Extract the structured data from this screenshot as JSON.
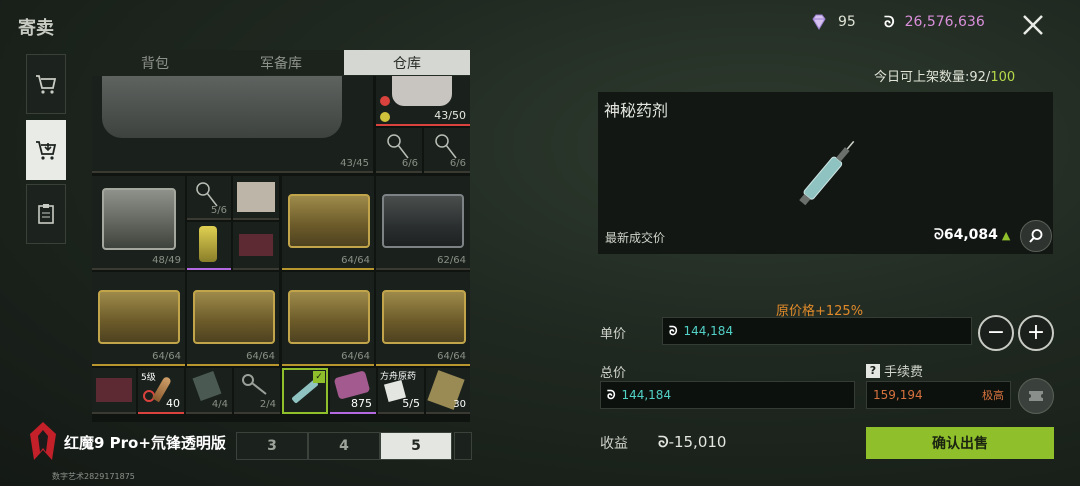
{
  "header": {
    "title": "寄卖",
    "diamonds": "95",
    "coins": "26,576,636",
    "quota_prefix": "今日可上架数量:92/",
    "quota_max": "100"
  },
  "tabs": [
    {
      "label": "背包",
      "active": false
    },
    {
      "label": "军备库",
      "active": false
    },
    {
      "label": "仓库",
      "active": true
    }
  ],
  "grid": {
    "counts": [
      "43/45",
      "43/50",
      "6/6",
      "6/6",
      "5/6",
      "48/49",
      "64/64",
      "62/64",
      "64/64",
      "64/64",
      "64/64",
      "64/64",
      "40",
      "4/4",
      "2/4",
      "875",
      "5/5",
      "30"
    ],
    "labels": {
      "level": "5级",
      "item_tag": "方舟原药"
    }
  },
  "pagination": {
    "pages": [
      "3",
      "4",
      "5"
    ],
    "active": "5"
  },
  "watermark": {
    "brand": "红魔9 Pro+氘锋透明版",
    "sub": "数字艺术2829171875"
  },
  "item": {
    "name": "神秘药剂",
    "last_price_label": "最新成交价",
    "last_price": "64,084"
  },
  "sell": {
    "original_pct": "原价格+125%",
    "unit_label": "单价",
    "unit_value": "144,184",
    "total_label": "总价",
    "total_value": "144,184",
    "fee_label": "手续费",
    "fee_value": "159,194",
    "fee_level": "极高",
    "profit_label": "收益",
    "profit_value": "-15,010",
    "confirm_label": "确认出售"
  },
  "colors": {
    "accent": "#8fbf2b",
    "coin_value": "#d98fd9",
    "cyan": "#52d1c6",
    "orange": "#e08a2a"
  }
}
